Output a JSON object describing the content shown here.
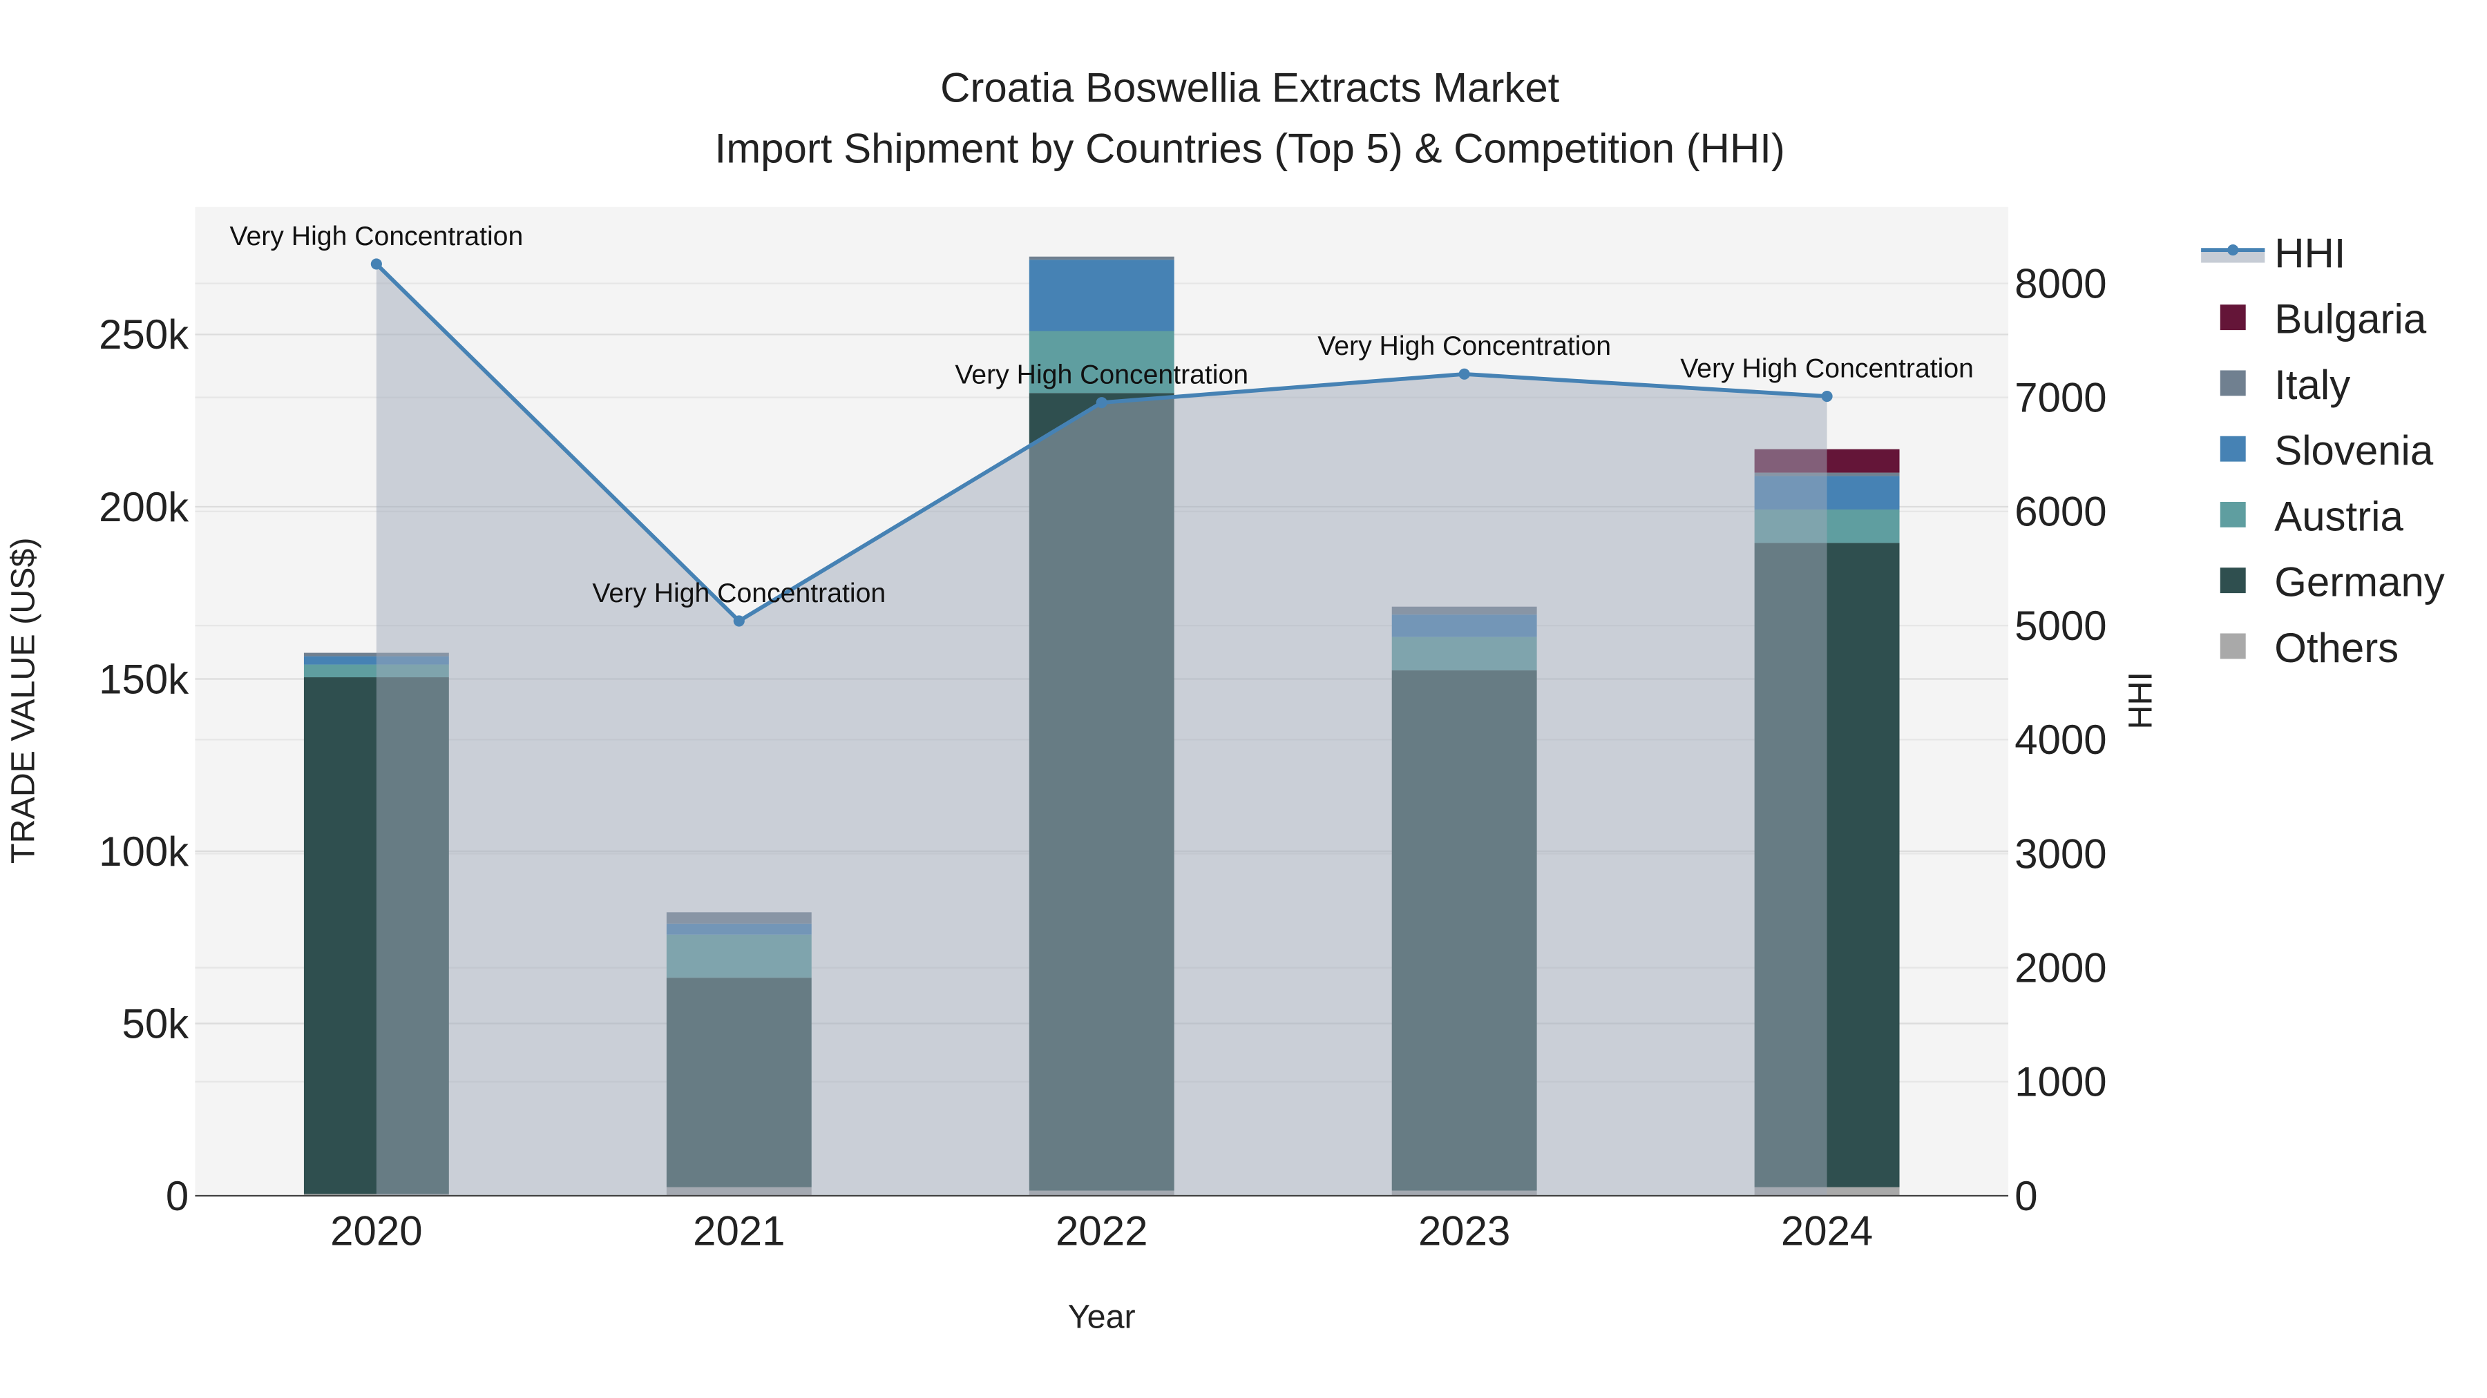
{
  "chart_data": {
    "type": "bar",
    "title": "Croatia Boswellia Extracts Market",
    "subtitle": "Import Shipment by Countries (Top 5) & Competition (HHI)",
    "xlabel": "Year",
    "ylabel": "TRADE VALUE (US$)",
    "y2label": "HHI",
    "categories": [
      "2020",
      "2021",
      "2022",
      "2023",
      "2024"
    ],
    "ylim": [
      0,
      287000
    ],
    "y2lim": [
      0,
      8670
    ],
    "yticks": [
      0,
      50000,
      100000,
      150000,
      200000,
      250000
    ],
    "ytick_labels": [
      "0",
      "50k",
      "100k",
      "150k",
      "200k",
      "250k"
    ],
    "y2ticks": [
      0,
      1000,
      2000,
      3000,
      4000,
      5000,
      6000,
      7000,
      8000
    ],
    "y2tick_labels": [
      "0",
      "1000",
      "2000",
      "3000",
      "4000",
      "5000",
      "6000",
      "7000",
      "8000"
    ],
    "grid": true,
    "legend_position": "right",
    "stacking": "stacked",
    "series": [
      {
        "name": "Others",
        "color": "#a9a9a9",
        "values": [
          500,
          2500,
          1500,
          1500,
          2500
        ]
      },
      {
        "name": "Germany",
        "color": "#2f4f4f",
        "values": [
          150000,
          60800,
          231500,
          151000,
          187000
        ]
      },
      {
        "name": "Austria",
        "color": "#5f9ea0",
        "values": [
          3700,
          12500,
          18000,
          9700,
          9700
        ]
      },
      {
        "name": "Slovenia",
        "color": "#4682b4",
        "values": [
          2400,
          3200,
          20700,
          6500,
          9700
        ]
      },
      {
        "name": "Italy",
        "color": "#708090",
        "values": [
          1000,
          3300,
          900,
          2300,
          1000
        ]
      },
      {
        "name": "Bulgaria",
        "color": "#641538",
        "values": [
          0,
          0,
          0,
          0,
          6800
        ]
      }
    ],
    "legend_order": [
      "HHI",
      "Bulgaria",
      "Italy",
      "Slovenia",
      "Austria",
      "Germany",
      "Others"
    ],
    "hhi": {
      "name": "HHI",
      "color": "#4682b4",
      "values": [
        8170,
        5040,
        6955,
        7205,
        7010
      ],
      "annotations": [
        "Very High Concentration",
        "Very High Concentration",
        "Very High Concentration",
        "Very High Concentration",
        "Very High Concentration"
      ]
    }
  }
}
